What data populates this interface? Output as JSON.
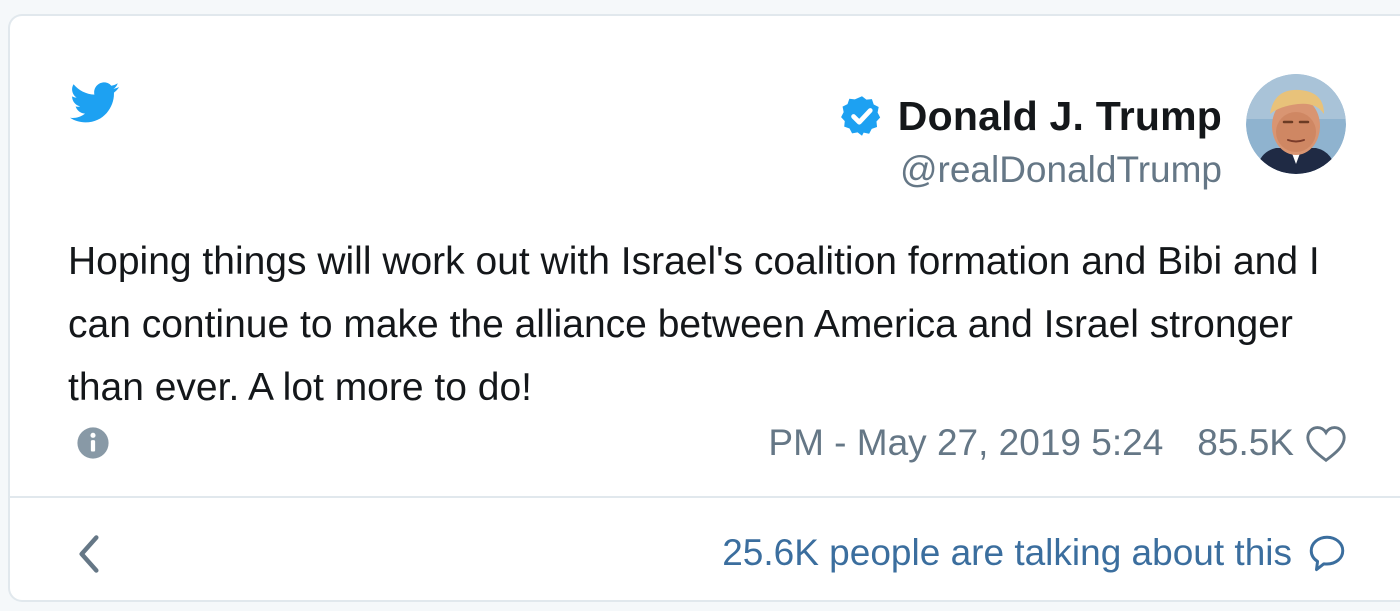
{
  "tweet": {
    "author_name": "Donald J. Trump",
    "handle": "@realDonaldTrump",
    "text": "Hoping things will work out with Israel's coalition formation and Bibi and I can continue to make the alliance between America and Israel stronger than ever. A lot more to do!",
    "timestamp": "PM - May 27, 2019 5:24",
    "likes": "85.5K",
    "talking": "25.6K people are talking about this"
  },
  "icons": {
    "brand": "twitter-bird-icon",
    "verified": "verified-badge-icon",
    "info": "info-icon",
    "like": "heart-icon",
    "back": "chevron-left-icon",
    "reply": "speech-bubble-icon"
  },
  "colors": {
    "twitter_blue": "#1da1f2",
    "text_primary": "#14171a",
    "text_secondary": "#657786",
    "link": "#3b6e9e",
    "border": "#e1e8ed"
  }
}
